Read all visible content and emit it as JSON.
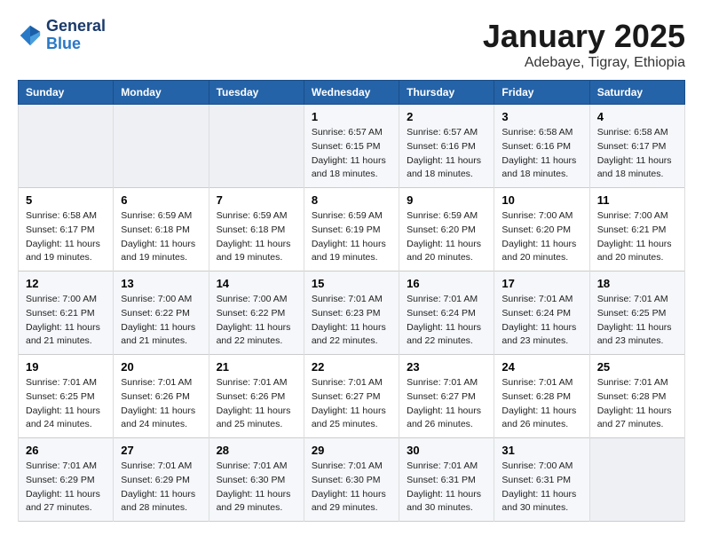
{
  "logo": {
    "line1": "General",
    "line2": "Blue"
  },
  "title": "January 2025",
  "subtitle": "Adebaye, Tigray, Ethiopia",
  "weekdays": [
    "Sunday",
    "Monday",
    "Tuesday",
    "Wednesday",
    "Thursday",
    "Friday",
    "Saturday"
  ],
  "weeks": [
    [
      {
        "day": "",
        "sunrise": "",
        "sunset": "",
        "daylight": ""
      },
      {
        "day": "",
        "sunrise": "",
        "sunset": "",
        "daylight": ""
      },
      {
        "day": "",
        "sunrise": "",
        "sunset": "",
        "daylight": ""
      },
      {
        "day": "1",
        "sunrise": "Sunrise: 6:57 AM",
        "sunset": "Sunset: 6:15 PM",
        "daylight": "Daylight: 11 hours and 18 minutes."
      },
      {
        "day": "2",
        "sunrise": "Sunrise: 6:57 AM",
        "sunset": "Sunset: 6:16 PM",
        "daylight": "Daylight: 11 hours and 18 minutes."
      },
      {
        "day": "3",
        "sunrise": "Sunrise: 6:58 AM",
        "sunset": "Sunset: 6:16 PM",
        "daylight": "Daylight: 11 hours and 18 minutes."
      },
      {
        "day": "4",
        "sunrise": "Sunrise: 6:58 AM",
        "sunset": "Sunset: 6:17 PM",
        "daylight": "Daylight: 11 hours and 18 minutes."
      }
    ],
    [
      {
        "day": "5",
        "sunrise": "Sunrise: 6:58 AM",
        "sunset": "Sunset: 6:17 PM",
        "daylight": "Daylight: 11 hours and 19 minutes."
      },
      {
        "day": "6",
        "sunrise": "Sunrise: 6:59 AM",
        "sunset": "Sunset: 6:18 PM",
        "daylight": "Daylight: 11 hours and 19 minutes."
      },
      {
        "day": "7",
        "sunrise": "Sunrise: 6:59 AM",
        "sunset": "Sunset: 6:18 PM",
        "daylight": "Daylight: 11 hours and 19 minutes."
      },
      {
        "day": "8",
        "sunrise": "Sunrise: 6:59 AM",
        "sunset": "Sunset: 6:19 PM",
        "daylight": "Daylight: 11 hours and 19 minutes."
      },
      {
        "day": "9",
        "sunrise": "Sunrise: 6:59 AM",
        "sunset": "Sunset: 6:20 PM",
        "daylight": "Daylight: 11 hours and 20 minutes."
      },
      {
        "day": "10",
        "sunrise": "Sunrise: 7:00 AM",
        "sunset": "Sunset: 6:20 PM",
        "daylight": "Daylight: 11 hours and 20 minutes."
      },
      {
        "day": "11",
        "sunrise": "Sunrise: 7:00 AM",
        "sunset": "Sunset: 6:21 PM",
        "daylight": "Daylight: 11 hours and 20 minutes."
      }
    ],
    [
      {
        "day": "12",
        "sunrise": "Sunrise: 7:00 AM",
        "sunset": "Sunset: 6:21 PM",
        "daylight": "Daylight: 11 hours and 21 minutes."
      },
      {
        "day": "13",
        "sunrise": "Sunrise: 7:00 AM",
        "sunset": "Sunset: 6:22 PM",
        "daylight": "Daylight: 11 hours and 21 minutes."
      },
      {
        "day": "14",
        "sunrise": "Sunrise: 7:00 AM",
        "sunset": "Sunset: 6:22 PM",
        "daylight": "Daylight: 11 hours and 22 minutes."
      },
      {
        "day": "15",
        "sunrise": "Sunrise: 7:01 AM",
        "sunset": "Sunset: 6:23 PM",
        "daylight": "Daylight: 11 hours and 22 minutes."
      },
      {
        "day": "16",
        "sunrise": "Sunrise: 7:01 AM",
        "sunset": "Sunset: 6:24 PM",
        "daylight": "Daylight: 11 hours and 22 minutes."
      },
      {
        "day": "17",
        "sunrise": "Sunrise: 7:01 AM",
        "sunset": "Sunset: 6:24 PM",
        "daylight": "Daylight: 11 hours and 23 minutes."
      },
      {
        "day": "18",
        "sunrise": "Sunrise: 7:01 AM",
        "sunset": "Sunset: 6:25 PM",
        "daylight": "Daylight: 11 hours and 23 minutes."
      }
    ],
    [
      {
        "day": "19",
        "sunrise": "Sunrise: 7:01 AM",
        "sunset": "Sunset: 6:25 PM",
        "daylight": "Daylight: 11 hours and 24 minutes."
      },
      {
        "day": "20",
        "sunrise": "Sunrise: 7:01 AM",
        "sunset": "Sunset: 6:26 PM",
        "daylight": "Daylight: 11 hours and 24 minutes."
      },
      {
        "day": "21",
        "sunrise": "Sunrise: 7:01 AM",
        "sunset": "Sunset: 6:26 PM",
        "daylight": "Daylight: 11 hours and 25 minutes."
      },
      {
        "day": "22",
        "sunrise": "Sunrise: 7:01 AM",
        "sunset": "Sunset: 6:27 PM",
        "daylight": "Daylight: 11 hours and 25 minutes."
      },
      {
        "day": "23",
        "sunrise": "Sunrise: 7:01 AM",
        "sunset": "Sunset: 6:27 PM",
        "daylight": "Daylight: 11 hours and 26 minutes."
      },
      {
        "day": "24",
        "sunrise": "Sunrise: 7:01 AM",
        "sunset": "Sunset: 6:28 PM",
        "daylight": "Daylight: 11 hours and 26 minutes."
      },
      {
        "day": "25",
        "sunrise": "Sunrise: 7:01 AM",
        "sunset": "Sunset: 6:28 PM",
        "daylight": "Daylight: 11 hours and 27 minutes."
      }
    ],
    [
      {
        "day": "26",
        "sunrise": "Sunrise: 7:01 AM",
        "sunset": "Sunset: 6:29 PM",
        "daylight": "Daylight: 11 hours and 27 minutes."
      },
      {
        "day": "27",
        "sunrise": "Sunrise: 7:01 AM",
        "sunset": "Sunset: 6:29 PM",
        "daylight": "Daylight: 11 hours and 28 minutes."
      },
      {
        "day": "28",
        "sunrise": "Sunrise: 7:01 AM",
        "sunset": "Sunset: 6:30 PM",
        "daylight": "Daylight: 11 hours and 29 minutes."
      },
      {
        "day": "29",
        "sunrise": "Sunrise: 7:01 AM",
        "sunset": "Sunset: 6:30 PM",
        "daylight": "Daylight: 11 hours and 29 minutes."
      },
      {
        "day": "30",
        "sunrise": "Sunrise: 7:01 AM",
        "sunset": "Sunset: 6:31 PM",
        "daylight": "Daylight: 11 hours and 30 minutes."
      },
      {
        "day": "31",
        "sunrise": "Sunrise: 7:00 AM",
        "sunset": "Sunset: 6:31 PM",
        "daylight": "Daylight: 11 hours and 30 minutes."
      },
      {
        "day": "",
        "sunrise": "",
        "sunset": "",
        "daylight": ""
      }
    ]
  ]
}
